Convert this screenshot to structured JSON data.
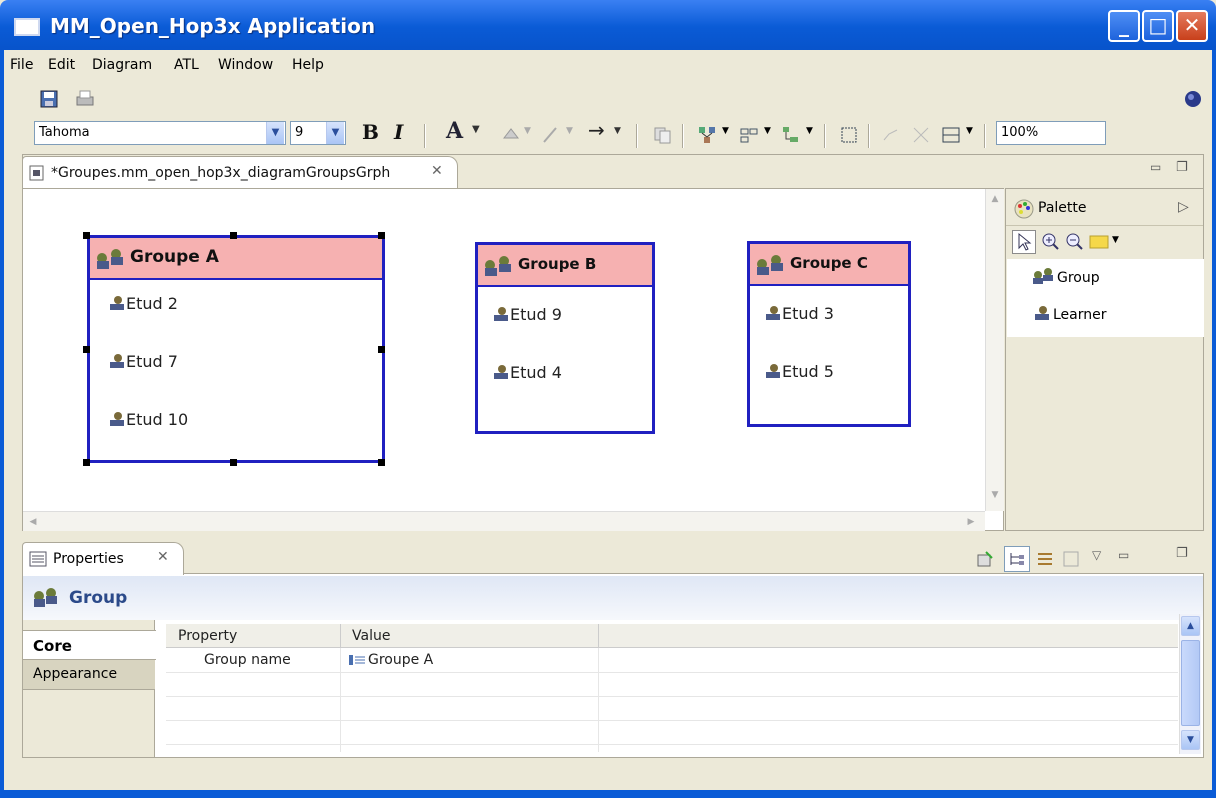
{
  "window": {
    "title": "MM_Open_Hop3x Application"
  },
  "menu": {
    "items": [
      "File",
      "Edit",
      "Diagram",
      "ATL",
      "Window",
      "Help"
    ]
  },
  "toolbar": {
    "font_name": "Tahoma",
    "font_size": "9",
    "bold_label": "B",
    "italic_label": "I",
    "font_color_label": "A",
    "zoom": "100%",
    "arrow_label": "→"
  },
  "editor": {
    "tab_label": "*Groupes.mm_open_hop3x_diagramGroupsGrph",
    "groups": [
      {
        "name": "Groupe A",
        "learners": [
          "Etud 2",
          "Etud 7",
          "Etud 10"
        ]
      },
      {
        "name": "Groupe B",
        "learners": [
          "Etud 9",
          "Etud 4"
        ]
      },
      {
        "name": "Groupe C",
        "learners": [
          "Etud 3",
          "Etud 5"
        ]
      }
    ]
  },
  "palette": {
    "title": "Palette",
    "tools": [
      "Group",
      "Learner"
    ]
  },
  "properties": {
    "tab_label": "Properties",
    "selection_title": "Group",
    "side_tabs": [
      "Core",
      "Appearance"
    ],
    "columns": [
      "Property",
      "Value"
    ],
    "rows": [
      {
        "property": "Group name",
        "value": "Groupe A"
      }
    ]
  },
  "colors": {
    "titlebar": "#0a5bd6",
    "group_header": "#f6b1b1",
    "group_border": "#2020c0"
  },
  "icons": [
    "save-icon",
    "print-icon",
    "globe-icon",
    "group-icon",
    "learner-icon",
    "palette-icon",
    "close-tab-icon"
  ]
}
